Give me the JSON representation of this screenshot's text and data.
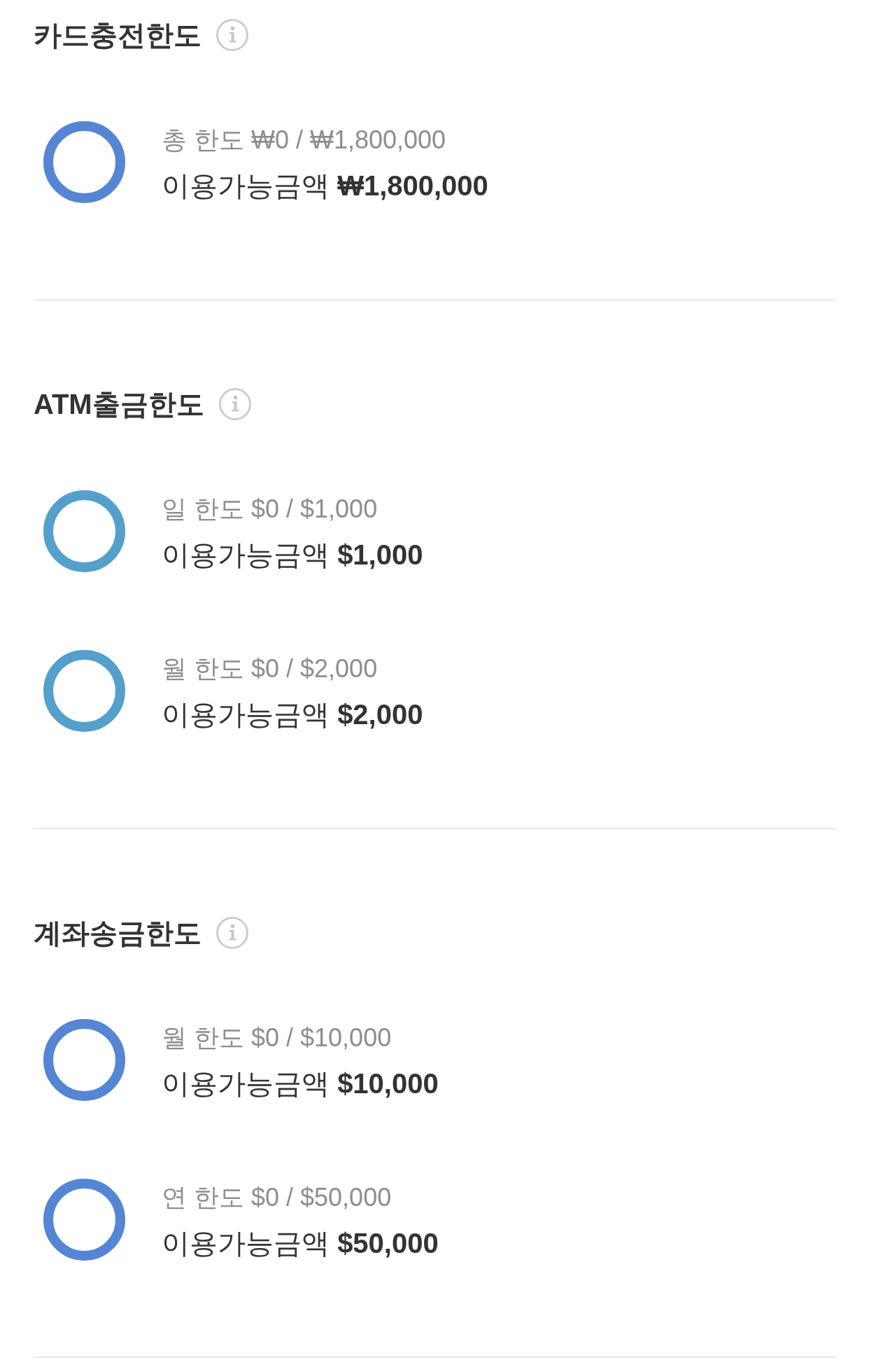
{
  "sections": [
    {
      "title": "카드충전한도",
      "limits": [
        {
          "usage": "총 한도 ₩0 / ₩1,800,000",
          "available": "이용가능금액 **₩1,800,000**",
          "color": "#5586d5"
        }
      ]
    },
    {
      "title": "ATM출금한도",
      "limits": [
        {
          "usage": "일 한도 $0 / $1,000",
          "available": "이용가능금액 **$1,000**",
          "color": "#54a0cc"
        },
        {
          "usage": "월 한도 $0 / $2,000",
          "available": "이용가능금액 **$2,000**",
          "color": "#54a0cc"
        }
      ]
    },
    {
      "title": "계좌송금한도",
      "limits": [
        {
          "usage": "월 한도 $0 / $10,000",
          "available": "이용가능금액 **$10,000**",
          "color": "#5586d5"
        },
        {
          "usage": "연 한도 $0 / $50,000",
          "available": "이용가능금액 **$50,000**",
          "color": "#5586d5"
        }
      ]
    }
  ]
}
